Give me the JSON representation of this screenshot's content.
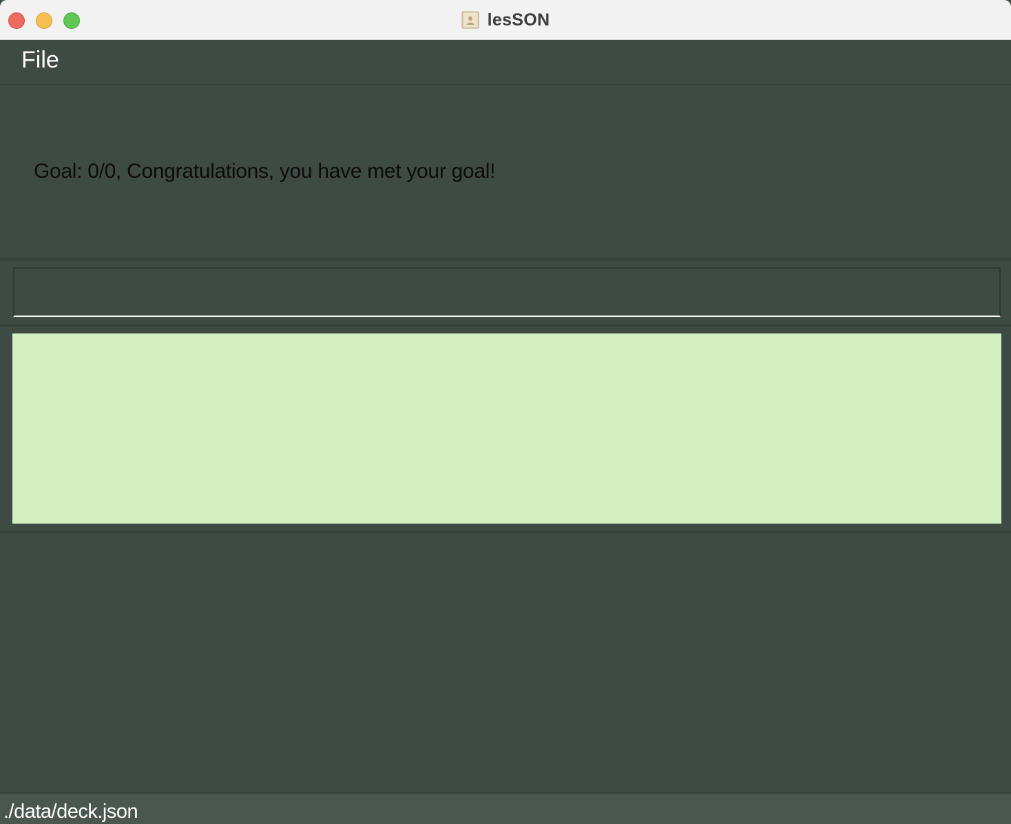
{
  "window": {
    "title": "lesSON",
    "controls": {
      "close_color": "#ec6a5e",
      "minimize_color": "#f4bf4f",
      "maximize_color": "#61c554"
    },
    "app_icon": "contact-card-icon"
  },
  "menubar": {
    "items": [
      {
        "label": "File"
      }
    ]
  },
  "goal": {
    "text": "Goal: 0/0, Congratulations, you have met your goal!"
  },
  "command_box": {
    "value": "",
    "placeholder": ""
  },
  "result_display": {
    "text": "",
    "background": "#d4efc0"
  },
  "status_bar": {
    "path": "./data/deck.json"
  },
  "colors": {
    "background": "#3e4b44",
    "status_background": "#4a5650"
  }
}
